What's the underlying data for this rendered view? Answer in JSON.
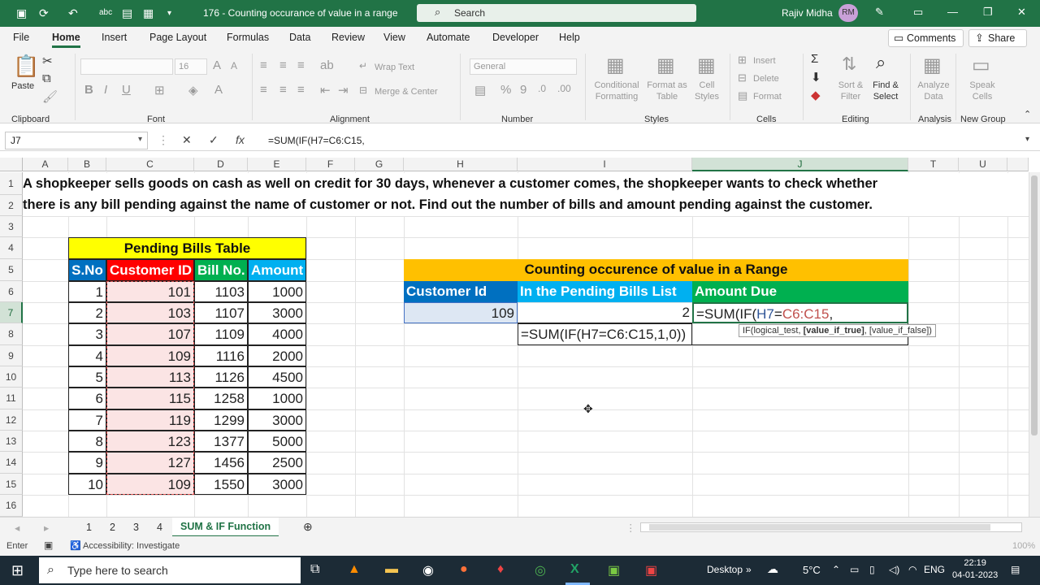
{
  "window": {
    "doc_title": "176 - Counting occurance of value in a range",
    "search_placeholder": "Search",
    "user_name": "Rajiv Midha",
    "user_initials": "RM"
  },
  "ribbon_tabs": [
    "File",
    "Home",
    "Insert",
    "Page Layout",
    "Formulas",
    "Data",
    "Review",
    "View",
    "Automate",
    "Developer",
    "Help"
  ],
  "active_tab": "Home",
  "comments_label": "Comments",
  "share_label": "Share",
  "ribbon": {
    "paste": "Paste",
    "clipboard": "Clipboard",
    "font_name": "",
    "font_size": "16",
    "font": "Font",
    "wrap_text": "Wrap Text",
    "merge_center": "Merge & Center",
    "alignment": "Alignment",
    "number_format": "General",
    "number": "Number",
    "conditional_formatting": "Conditional Formatting",
    "format_as_table": "Format as Table",
    "cell_styles": "Cell Styles",
    "styles": "Styles",
    "insert": "Insert",
    "delete": "Delete",
    "format": "Format",
    "cells": "Cells",
    "sort_filter": "Sort & Filter",
    "find_select": "Find & Select",
    "editing": "Editing",
    "analyze_data": "Analyze Data",
    "analysis": "Analysis",
    "speak_cells": "Speak Cells",
    "new_group": "New Group"
  },
  "formula_bar": {
    "name_box": "J7",
    "formula": "=SUM(IF(H7=C6:C15,"
  },
  "columns": [
    "A",
    "B",
    "C",
    "D",
    "E",
    "F",
    "G",
    "H",
    "I",
    "J",
    "T",
    "U"
  ],
  "rows": [
    "1",
    "2",
    "3",
    "4",
    "5",
    "6",
    "7",
    "8",
    "9",
    "10",
    "11",
    "12",
    "13",
    "14",
    "15",
    "16"
  ],
  "problem_line1": "A shopkeeper sells goods on cash as well on credit for 30 days, whenever a customer comes, the shopkeeper wants to check whether",
  "problem_line2": "there is any bill pending against the name of customer or not. Find out the number of bills and amount pending against the customer.",
  "pending_table": {
    "title": "Pending Bills Table",
    "headers": [
      "S.No",
      "Customer ID",
      "Bill No.",
      "Amount"
    ],
    "rows": [
      [
        "1",
        "101",
        "1103",
        "1000"
      ],
      [
        "2",
        "103",
        "1107",
        "3000"
      ],
      [
        "3",
        "107",
        "1109",
        "4000"
      ],
      [
        "4",
        "109",
        "1116",
        "2000"
      ],
      [
        "5",
        "113",
        "1126",
        "4500"
      ],
      [
        "6",
        "115",
        "1258",
        "1000"
      ],
      [
        "7",
        "119",
        "1299",
        "3000"
      ],
      [
        "8",
        "123",
        "1377",
        "5000"
      ],
      [
        "9",
        "127",
        "1456",
        "2500"
      ],
      [
        "10",
        "109",
        "1550",
        "3000"
      ]
    ]
  },
  "count_table": {
    "title": "Counting occurence of  value  in a Range",
    "headers": [
      "Customer Id",
      "In the Pending Bills List",
      "Amount Due"
    ],
    "customer_id": "109",
    "count": "2",
    "count_formula": "=SUM(IF(H7=C6:C15,1,0))",
    "amount_formula_prefix": "=SUM(IF(",
    "amount_formula_ref1": "H7",
    "amount_formula_eq": "=",
    "amount_formula_ref2": "C6:C15",
    "amount_formula_suffix": ","
  },
  "tooltip": {
    "a": "IF(logical_test, ",
    "b": "[value_if_true]",
    "c": ", [value_if_false])"
  },
  "sheet_tabs": [
    "1",
    "2",
    "3",
    "4",
    "SUM & IF Function"
  ],
  "status": {
    "mode": "Enter",
    "accessibility": "Accessibility: Investigate",
    "zoom": "100%"
  },
  "taskbar": {
    "search": "Type here to search",
    "desktop": "Desktop",
    "temp": "5°C",
    "lang": "ENG",
    "time": "22:19",
    "date": "04-01-2023"
  },
  "colors": {
    "excel_green": "#217346",
    "blue_header": "#0070c0",
    "red_header": "#ff0000",
    "cyan_header": "#00b0f0",
    "orange_header": "#ffc000",
    "green_header": "#00b050"
  }
}
